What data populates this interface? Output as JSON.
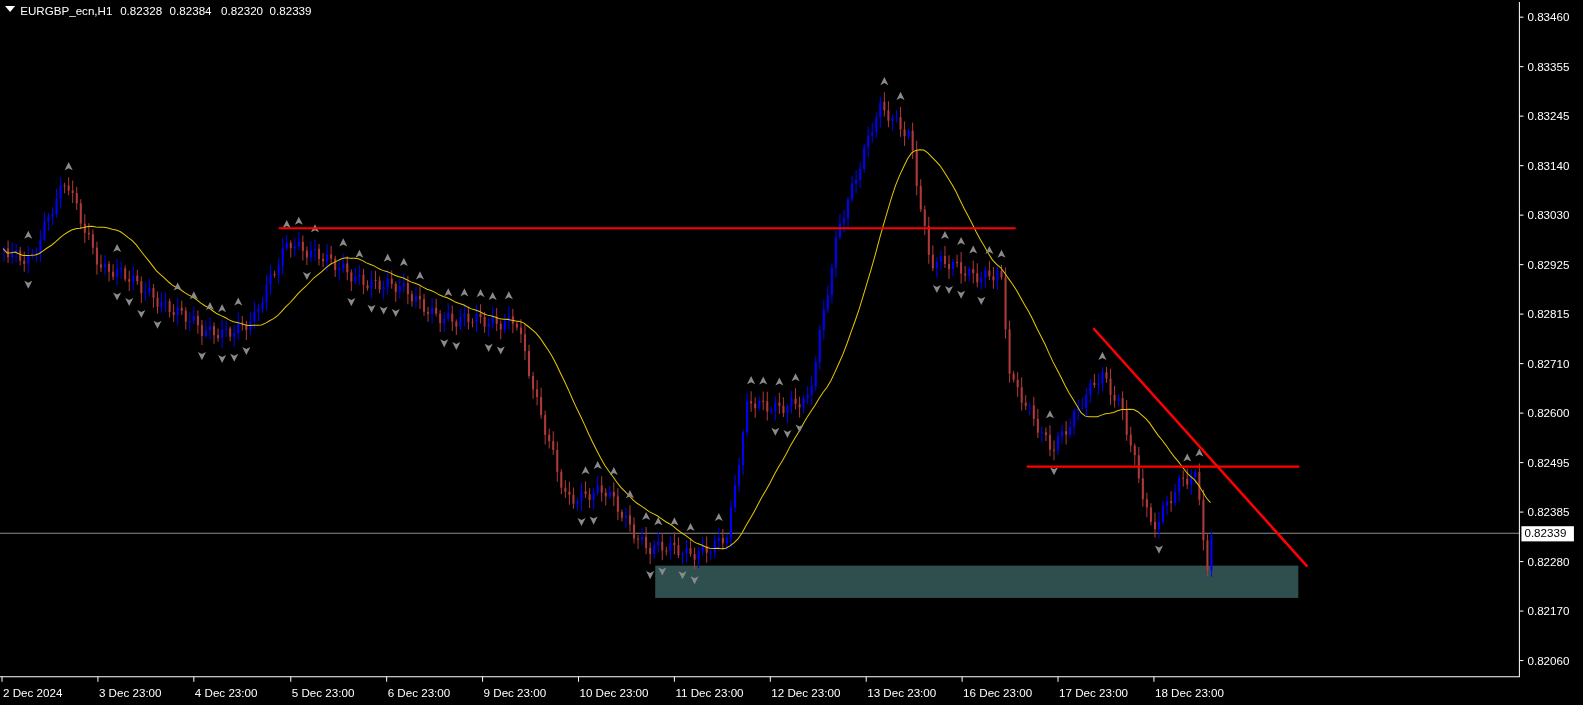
{
  "header": {
    "symbol": "EURGBP_ecn,H1",
    "quotes": [
      "0.82328",
      "0.82384",
      "0.82320",
      "0.82339"
    ]
  },
  "price_axis": {
    "labels": [
      "0.83460",
      "0.83355",
      "0.83245",
      "0.83140",
      "0.83030",
      "0.82925",
      "0.82815",
      "0.82710",
      "0.82600",
      "0.82495",
      "0.82385",
      "0.82280",
      "0.82170",
      "0.82060"
    ],
    "current_price": "0.82339"
  },
  "time_axis": {
    "labels": [
      "2 Dec 2024",
      "3 Dec 23:00",
      "4 Dec 23:00",
      "5 Dec 23:00",
      "6 Dec 23:00",
      "9 Dec 23:00",
      "10 Dec 23:00",
      "11 Dec 23:00",
      "12 Dec 23:00",
      "13 Dec 23:00",
      "16 Dec 23:00",
      "17 Dec 23:00",
      "18 Dec 23:00"
    ]
  }
}
